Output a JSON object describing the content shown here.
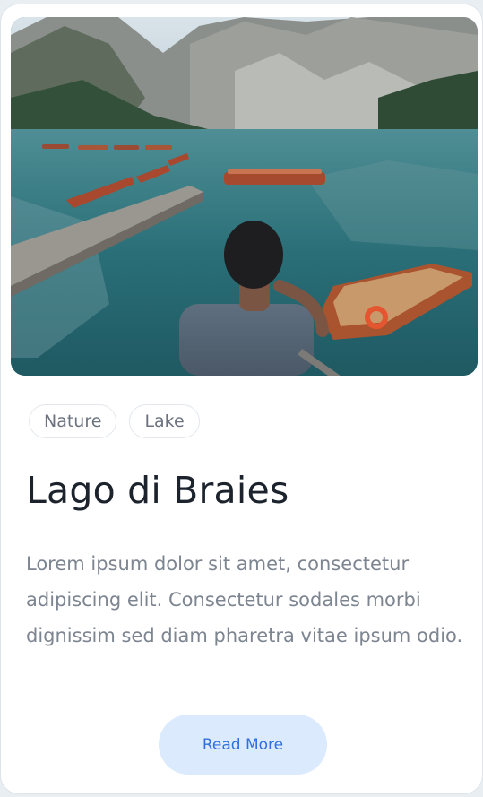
{
  "card": {
    "image_subject": "person sitting on a dock looking at a mountain lake with wooden rowboats",
    "tags": [
      "Nature",
      "Lake"
    ],
    "title": "Lago di Braies",
    "description": "Lorem ipsum dolor sit amet, consectetur adipiscing elit. Consectetur sodales morbi dignissim sed diam pharetra vitae ipsum odio.",
    "button_label": "Read More"
  },
  "colors": {
    "button_bg": "#dceafd",
    "button_text": "#2f6fe0",
    "title": "#1c232d",
    "body_text": "#7d8591",
    "tag_border": "#e3e7ec",
    "lake": "#2a6f78"
  }
}
